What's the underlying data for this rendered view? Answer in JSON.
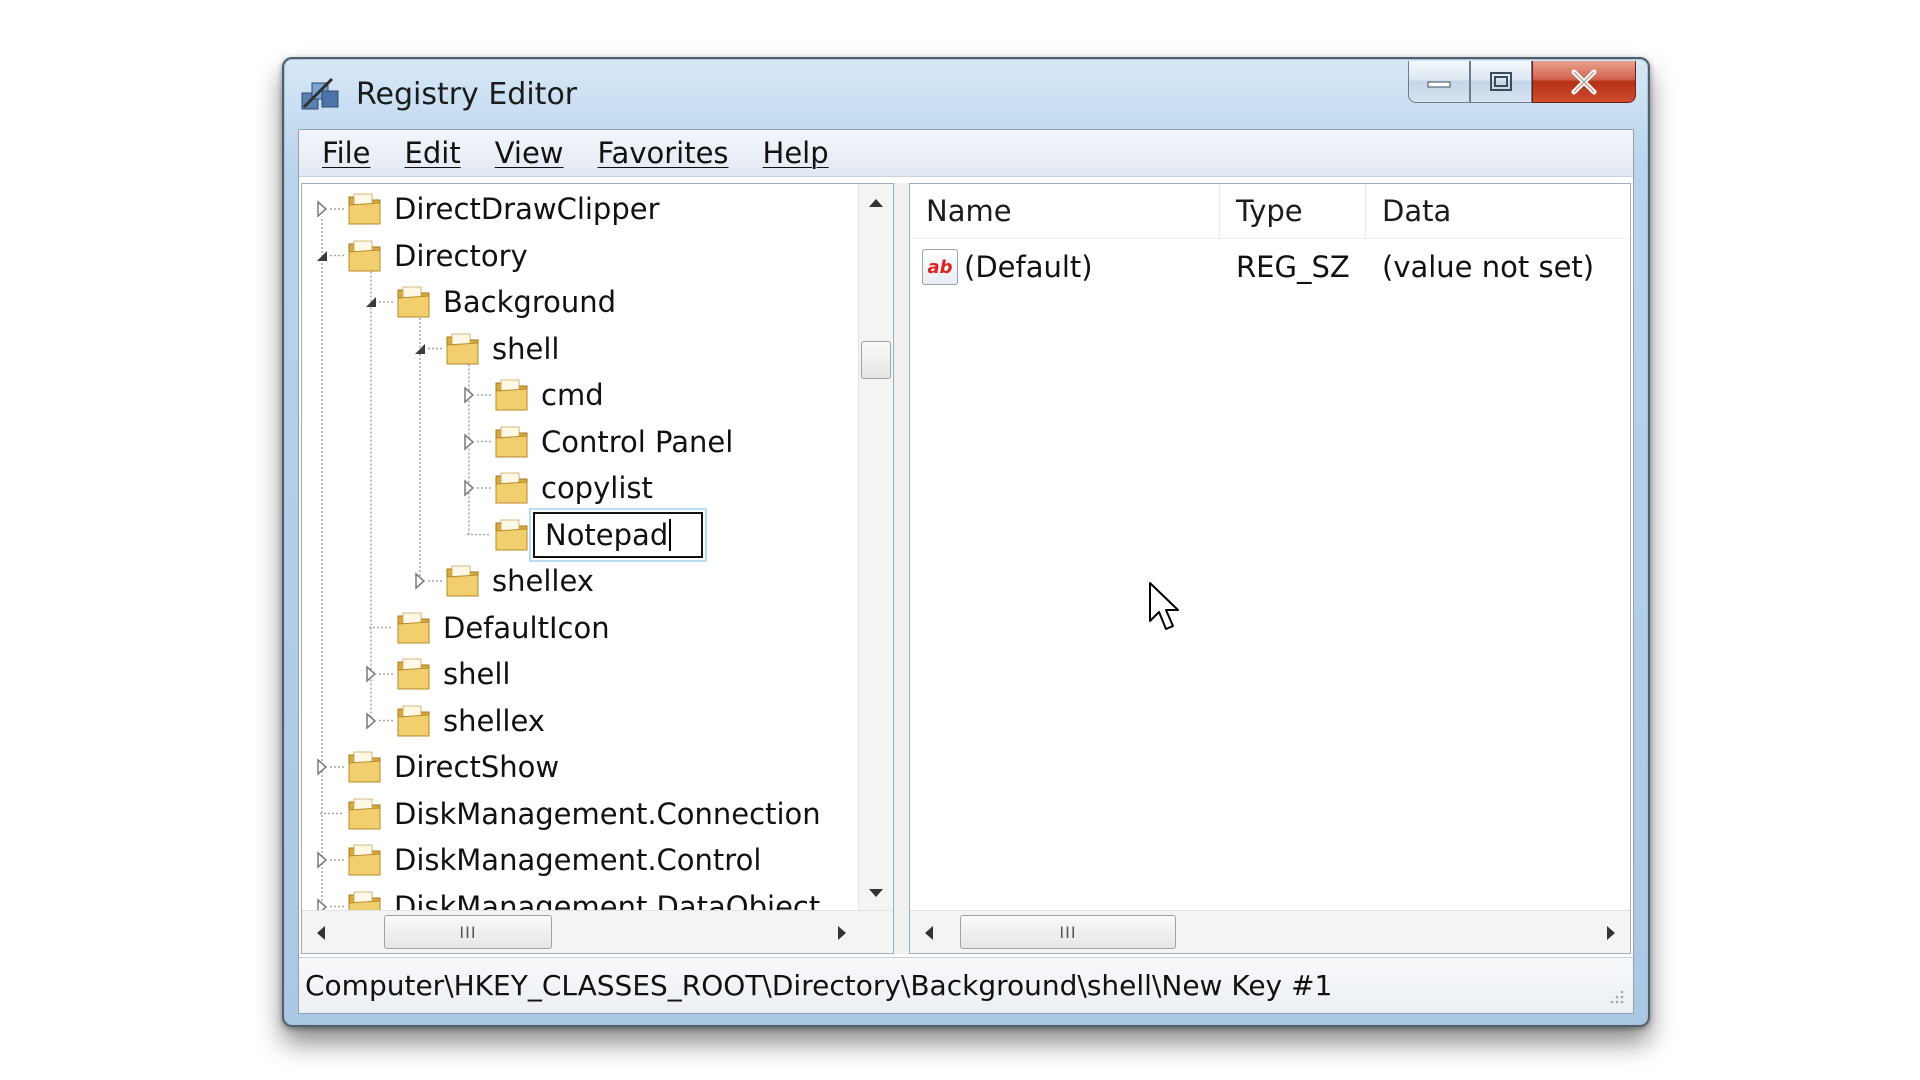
{
  "window": {
    "title": "Registry Editor",
    "icon": "registry-editor-icon",
    "controls": {
      "minimize": "minimize-icon",
      "maximize": "maximize-icon",
      "close": "close-icon"
    }
  },
  "menu": [
    "File",
    "Edit",
    "View",
    "Favorites",
    "Help"
  ],
  "tree": {
    "items": [
      {
        "label": "DirectDrawClipper",
        "level": 0,
        "state": "collapsed"
      },
      {
        "label": "Directory",
        "level": 0,
        "state": "expanded"
      },
      {
        "label": "Background",
        "level": 1,
        "state": "expanded"
      },
      {
        "label": "shell",
        "level": 2,
        "state": "expanded"
      },
      {
        "label": "cmd",
        "level": 3,
        "state": "collapsed"
      },
      {
        "label": "Control Panel",
        "level": 3,
        "state": "collapsed"
      },
      {
        "label": "copylist",
        "level": 3,
        "state": "collapsed"
      },
      {
        "label": "Notepad",
        "level": 3,
        "state": "editing"
      },
      {
        "label": "shellex",
        "level": 2,
        "state": "collapsed"
      },
      {
        "label": "DefaultIcon",
        "level": 1,
        "state": "leaf"
      },
      {
        "label": "shell",
        "level": 1,
        "state": "collapsed"
      },
      {
        "label": "shellex",
        "level": 1,
        "state": "collapsed"
      },
      {
        "label": "DirectShow",
        "level": 0,
        "state": "collapsed"
      },
      {
        "label": "DiskManagement.Connection",
        "level": 0,
        "state": "leaf"
      },
      {
        "label": "DiskManagement.Control",
        "level": 0,
        "state": "collapsed"
      },
      {
        "label": "DiskManagement.DataObject",
        "level": 0,
        "state": "collapsed"
      }
    ],
    "vertical_scroll_position": 0.2,
    "horizontal_scroll_grip": "III"
  },
  "values": {
    "columns": [
      "Name",
      "Type",
      "Data"
    ],
    "rows": [
      {
        "icon": "string-value-icon",
        "icon_text": "ab",
        "name": "(Default)",
        "type": "REG_SZ",
        "data": "(value not set)"
      }
    ],
    "horizontal_scroll_grip": "III"
  },
  "status": "Computer\\HKEY_CLASSES_ROOT\\Directory\\Background\\shell\\New Key #1",
  "colors": {
    "title_bar": "#c7ddf1",
    "close_button": "#c4442a",
    "folder": "#e8c35a"
  }
}
